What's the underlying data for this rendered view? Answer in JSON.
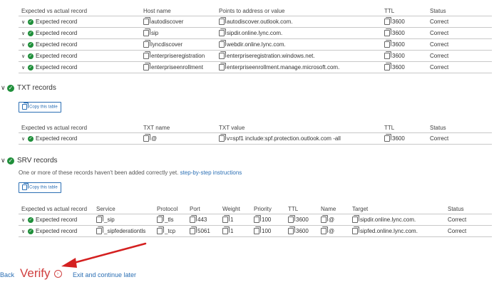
{
  "dns_table": {
    "headers": [
      "Expected vs actual record",
      "Host name",
      "Points to address or value",
      "TTL",
      "Status"
    ],
    "rows": [
      {
        "expected": "Expected record",
        "host": "autodiscover",
        "value": "autodiscover.outlook.com.",
        "ttl": "3600",
        "status": "Correct"
      },
      {
        "expected": "Expected record",
        "host": "sip",
        "value": "sipdir.online.lync.com.",
        "ttl": "3600",
        "status": "Correct"
      },
      {
        "expected": "Expected record",
        "host": "lyncdiscover",
        "value": "webdir.online.lync.com.",
        "ttl": "3600",
        "status": "Correct"
      },
      {
        "expected": "Expected record",
        "host": "enterpriseregistration",
        "value": "enterpriseregistration.windows.net.",
        "ttl": "3600",
        "status": "Correct"
      },
      {
        "expected": "Expected record",
        "host": "enterpriseenrollment",
        "value": "enterpriseenrollment.manage.microsoft.com.",
        "ttl": "3600",
        "status": "Correct"
      }
    ]
  },
  "txt": {
    "title": "TXT records",
    "copy_label": "Copy this table",
    "headers": [
      "Expected vs actual record",
      "TXT name",
      "TXT value",
      "TTL",
      "Status"
    ],
    "rows": [
      {
        "expected": "Expected record",
        "name": "@",
        "value": "v=spf1 include:spf.protection.outlook.com -all",
        "ttl": "3600",
        "status": "Correct"
      }
    ]
  },
  "srv": {
    "title": "SRV records",
    "note": "One or more of these records haven't been added correctly yet.",
    "note_link": "step-by-step instructions",
    "copy_label": "Copy this table",
    "headers": [
      "Expected vs actual record",
      "Service",
      "Protocol",
      "Port",
      "Weight",
      "Priority",
      "TTL",
      "Name",
      "Target",
      "Status"
    ],
    "rows": [
      {
        "expected": "Expected record",
        "service": "_sip",
        "protocol": "_tls",
        "port": "443",
        "weight": "1",
        "priority": "100",
        "ttl": "3600",
        "name": "@",
        "target": "sipdir.online.lync.com.",
        "status": "Correct"
      },
      {
        "expected": "Expected record",
        "service": "_sipfederationtls",
        "protocol": "_tcp",
        "port": "5061",
        "weight": "1",
        "priority": "100",
        "ttl": "3600",
        "name": "@",
        "target": "sipfed.online.lync.com.",
        "status": "Correct"
      }
    ]
  },
  "footer": {
    "back": "Back",
    "verify": "Verify",
    "exit": "Exit and continue later"
  },
  "colors": {
    "accent": "#2b6fb4",
    "success": "#1f8f3a",
    "verify": "#d04040",
    "arrow": "#d42020"
  }
}
